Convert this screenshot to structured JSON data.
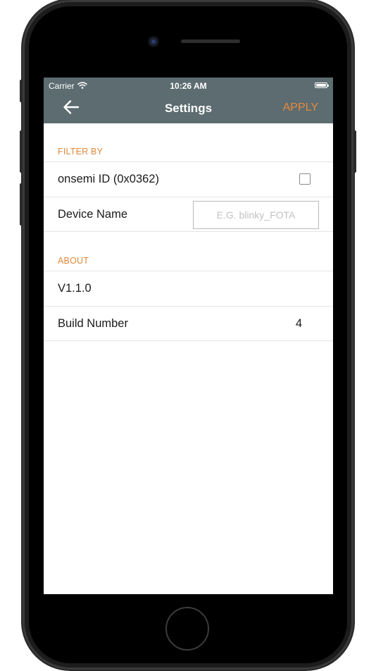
{
  "status_bar": {
    "carrier": "Carrier",
    "time": "10:26 AM"
  },
  "navbar": {
    "title": "Settings",
    "apply_label": "APPLY"
  },
  "filter_section": {
    "header": "FILTER BY",
    "onsemi_id_label": "onsemi ID (0x0362)",
    "onsemi_id_checked": false,
    "device_name_label": "Device Name",
    "device_name_value": "",
    "device_name_placeholder": "E.G. blinky_FOTA"
  },
  "about_section": {
    "header": "ABOUT",
    "version_label": "V1.1.0",
    "build_number_label": "Build Number",
    "build_number_value": "4"
  },
  "colors": {
    "navbar_bg": "#5c6c70",
    "accent": "#e8893d"
  }
}
